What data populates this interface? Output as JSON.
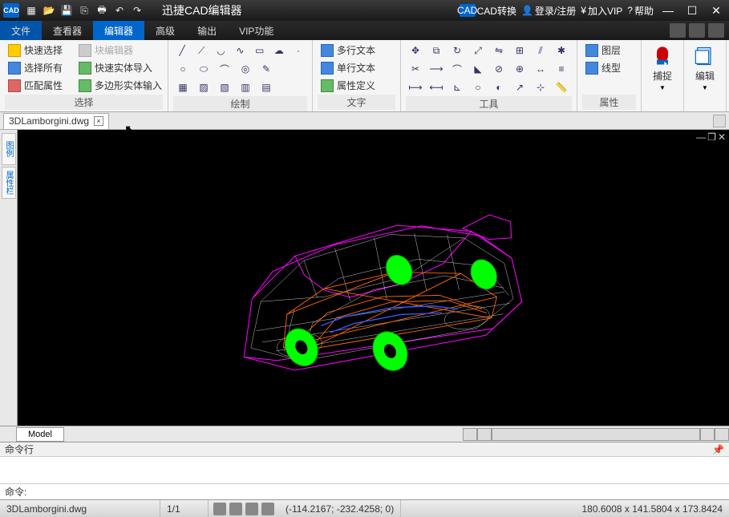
{
  "titlebar": {
    "logo": "CAD",
    "title": "迅捷CAD编辑器",
    "convert": "CAD转换",
    "login": "登录/注册",
    "vip": "加入VIP",
    "help": "帮助"
  },
  "menu": {
    "items": [
      "文件",
      "查看器",
      "编辑器",
      "高级",
      "输出",
      "VIP功能"
    ],
    "active": 2
  },
  "ribbon": {
    "select": {
      "label": "选择",
      "quick": "快速选择",
      "block": "块编辑器",
      "selall": "选择所有",
      "entity": "快速实体导入",
      "match": "匹配属性",
      "poly": "多边形实体输入"
    },
    "draw": {
      "label": "绘制"
    },
    "text": {
      "label": "文字",
      "multi": "多行文本",
      "single": "单行文本",
      "attr": "属性定义"
    },
    "tools": {
      "label": "工具"
    },
    "props": {
      "label": "属性",
      "layer": "图层",
      "linetype": "线型"
    },
    "snap": "捕捉",
    "edit": "编辑"
  },
  "doc": {
    "filename": "3DLamborgini.dwg"
  },
  "sidepanels": [
    "图例",
    "属性栏"
  ],
  "model": {
    "tab": "Model"
  },
  "cmd": {
    "title": "命令行",
    "prompt": "命令:"
  },
  "status": {
    "file": "3DLamborgini.dwg",
    "page": "1/1",
    "coords": "(-114.2167; -232.4258; 0)",
    "dims": "180.6008 x 141.5804 x 173.8424"
  }
}
